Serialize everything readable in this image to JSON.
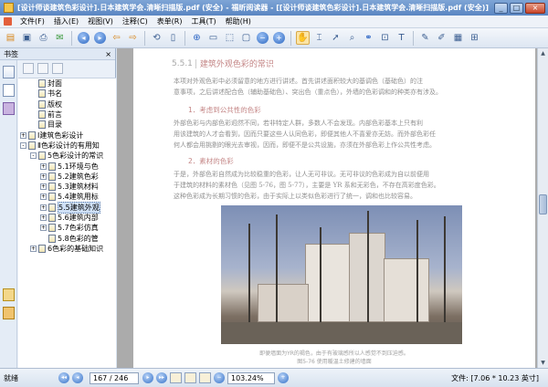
{
  "window": {
    "title": "[设计师谈建筑色彩设计].日本建筑学会.清晰扫描版.pdf (安全) - 福昕阅读器 - [[设计师谈建筑色彩设计].日本建筑学会.清晰扫描版.pdf (安全)]",
    "minimize": "_",
    "maximize": "□",
    "close": "×"
  },
  "menu": [
    "文件(F)",
    "插入(E)",
    "视图(V)",
    "注释(C)",
    "表单(R)",
    "工具(T)",
    "帮助(H)"
  ],
  "toolbar_icons": [
    "open-icon",
    "save-icon",
    "print-icon",
    "email-icon",
    "first-page-icon",
    "back-icon",
    "forward-icon",
    "last-page-icon",
    "rotate-icon",
    "page-icon",
    "zoom-in-icon",
    "fit-page-icon",
    "fit-width-icon",
    "zoom-out-icon",
    "zoom-plus-icon",
    "hand-icon",
    "select-icon",
    "text-select-icon",
    "find-icon",
    "snapshot-icon",
    "typewriter-icon",
    "note-icon",
    "highlight-icon",
    "stamp-icon"
  ],
  "bookmarks_panel": {
    "title": "书签",
    "close": "×",
    "items": [
      {
        "label": "封面",
        "level": 1,
        "expander": ""
      },
      {
        "label": "书名",
        "level": 1,
        "expander": ""
      },
      {
        "label": "版权",
        "level": 1,
        "expander": ""
      },
      {
        "label": "前言",
        "level": 1,
        "expander": ""
      },
      {
        "label": "目录",
        "level": 1,
        "expander": ""
      },
      {
        "label": "Ⅰ建筑色彩设计",
        "level": 0,
        "expander": "+"
      },
      {
        "label": "Ⅱ色彩设计的有用知",
        "level": 0,
        "expander": "-"
      },
      {
        "label": "5色彩设计的常识",
        "level": 1,
        "expander": "-"
      },
      {
        "label": "5.1环境与色",
        "level": 2,
        "expander": "+"
      },
      {
        "label": "5.2建筑色彩",
        "level": 2,
        "expander": "+"
      },
      {
        "label": "5.3建筑材料",
        "level": 2,
        "expander": "+"
      },
      {
        "label": "5.4建筑用标",
        "level": 2,
        "expander": "+"
      },
      {
        "label": "5.5建筑外观",
        "level": 2,
        "expander": "+",
        "selected": true
      },
      {
        "label": "5.6建筑内部",
        "level": 2,
        "expander": "+"
      },
      {
        "label": "5.7色彩仿真",
        "level": 2,
        "expander": "+"
      },
      {
        "label": "5.8色彩的管",
        "level": 2,
        "expander": ""
      },
      {
        "label": "6色彩的基础知识",
        "level": 1,
        "expander": "+"
      }
    ]
  },
  "page": {
    "section_number": "5.5.1",
    "section_title": "建筑外观色彩的常识",
    "para1_l1": "本项对外观色彩中必须留意的地方进行讲述。首先讲述面积较大的基调色（基础色）的注",
    "para1_l2": "意事项，之后讲述配合色（辅助基础色）、突出色（重点色），外墙的色彩调和的种类亦有涉及。",
    "sub1": "1．考虑到公共性的色彩",
    "para2_l1": "外部色彩与内部色彩迥然不同，若非特定人群，多数人不会发现。内部色彩基本上只有利",
    "para2_l2": "用该建筑的人才会看到，因而只要这些人认同色彩，即便其他人不喜爱亦无妨。而外部色彩任",
    "para2_l3": "何人都会用挑剔的眼光去审视，因而，即便不是公共设施，亦须在外部色彩上作公共性考虑。",
    "sub2": "2．素材的色彩",
    "para3_l1": "于是，外部色彩自然成为比较稳重的色彩，让人无可非议。无可非议的色彩成为自以前便用",
    "para3_l2": "于建筑的材料的素材色（见图 5-76，图 5-77），主要是 YR 系和无彩色，不存在高彩度色彩。",
    "para3_l3": "这种色彩成为长期习惯的色彩，由于实际上以类似色彩进行了统一，调和也比较容易。",
    "caption1": "即便墙面为YR的褐色，由于有玻璃感所以人感觉不到压迫感。",
    "caption2": "图5-76  使用暖温土修建的墙面"
  },
  "status": {
    "ready": "就绪",
    "page_current": "167 / 246",
    "zoom": "103.24%",
    "file_size": "文件: [7.06 * 10.23 英寸]"
  }
}
